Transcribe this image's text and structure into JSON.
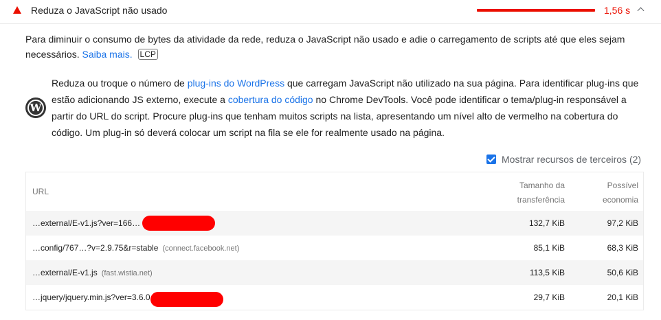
{
  "audit": {
    "title": "Reduza o JavaScript não usado",
    "savings": "1,56 s",
    "status_color": "#eb0f00"
  },
  "description": {
    "text": "Para diminuir o consumo de bytes da atividade da rede, reduza o JavaScript não usado e adie o carregamento de scripts até que eles sejam necessários.",
    "learn_more": "Saiba mais.",
    "badge": "LCP"
  },
  "stack_pack": {
    "icon": "wordpress-icon",
    "text_1": "Reduza ou troque o número de ",
    "link_1": "plug-ins do WordPress",
    "text_2": " que carregam JavaScript não utilizado na sua página. Para identificar plug-ins que estão adicionando JS externo, execute a ",
    "link_2": "cobertura do código",
    "text_3": " no Chrome DevTools. Você pode identificar o tema/plug-in responsável a partir do URL do script. Procure plug-ins que tenham muitos scripts na lista, apresentando um nível alto de vermelho na cobertura do código. Um plug-in só deverá colocar um script na fila se ele for realmente usado na página."
  },
  "third_party": {
    "label": "Mostrar recursos de terceiros (2)",
    "checked": true
  },
  "table": {
    "headers": {
      "url": "URL",
      "size_1": "Tamanho da",
      "size_2": "transferência",
      "savings_1": "Possível",
      "savings_2": "economia"
    },
    "rows": [
      {
        "url": "…external/E-v1.js?ver=166…",
        "host": "",
        "size": "132,7 KiB",
        "savings": "97,2 KiB"
      },
      {
        "url": "…config/767…?v=2.9.75&r=stable",
        "host": "(connect.facebook.net)",
        "size": "85,1 KiB",
        "savings": "68,3 KiB"
      },
      {
        "url": "…external/E-v1.js",
        "host": "(fast.wistia.net)",
        "size": "113,5 KiB",
        "savings": "50,6 KiB"
      },
      {
        "url": "…jquery/jquery.min.js?ver=3.6.0",
        "host": "",
        "size": "29,7 KiB",
        "savings": "20,1 KiB"
      }
    ]
  }
}
